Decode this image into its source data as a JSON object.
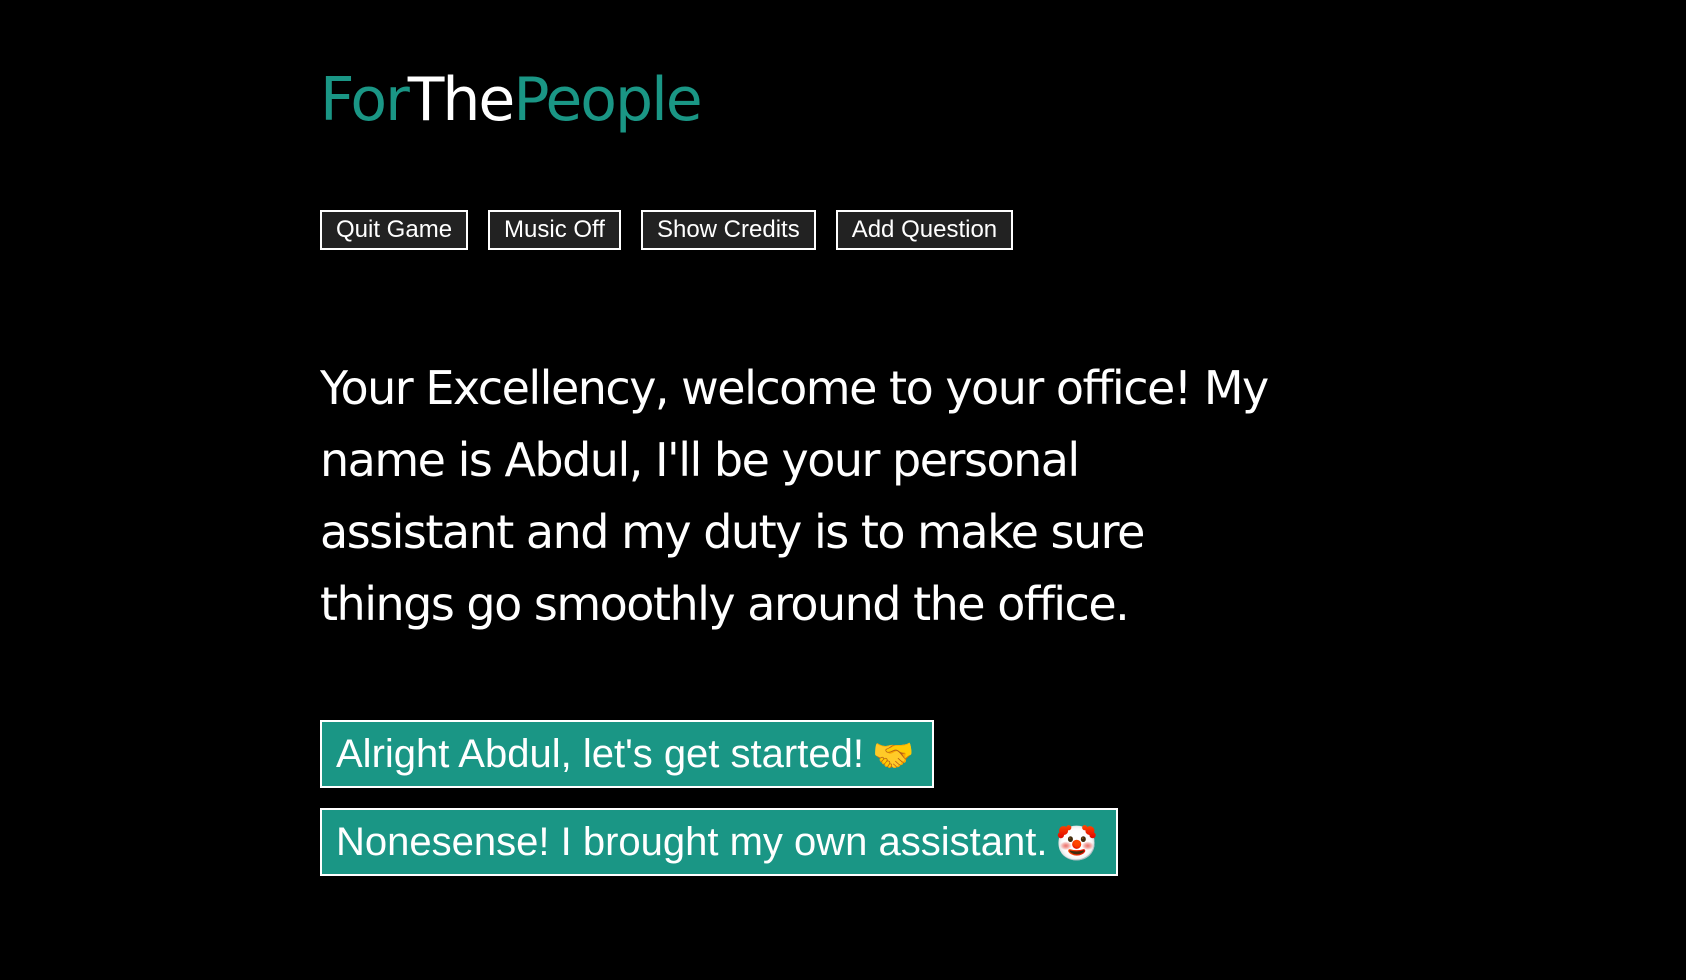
{
  "logo": {
    "part1": "For",
    "part2": "The",
    "part3": "People"
  },
  "toolbar": {
    "quit_label": "Quit Game",
    "music_label": "Music Off",
    "credits_label": "Show Credits",
    "add_question_label": "Add Question"
  },
  "dialogue": {
    "text": "Your Excellency, welcome to your office! My name is Abdul, I'll be your personal assistant and my duty is to make sure things go smoothly around the office."
  },
  "choices": [
    {
      "label": "Alright Abdul, let's get started!",
      "emoji": "🤝"
    },
    {
      "label": "Nonesense! I brought my own assistant.",
      "emoji": "🤡"
    }
  ],
  "colors": {
    "accent": "#1a9685",
    "background": "#000000",
    "text": "#ffffff"
  }
}
